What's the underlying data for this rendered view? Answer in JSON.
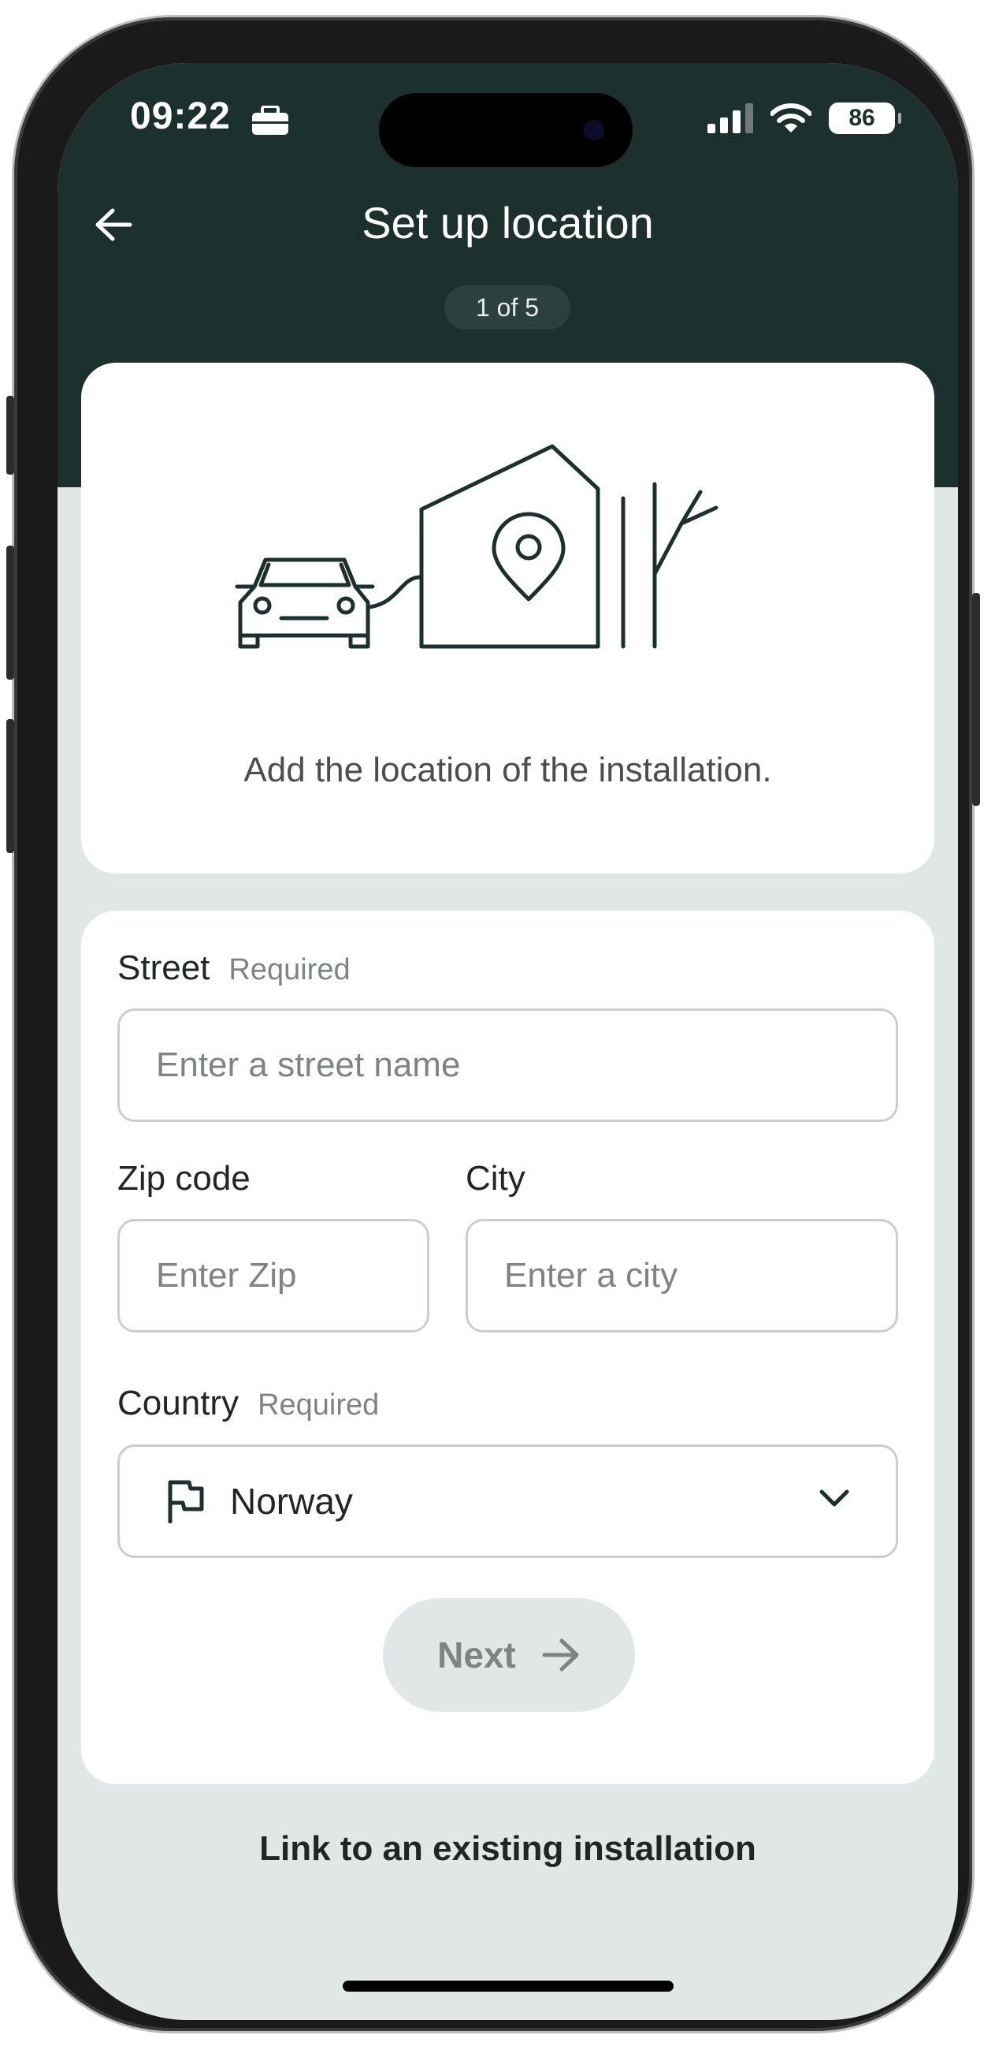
{
  "status_bar": {
    "time": "09:22",
    "battery": "86"
  },
  "header": {
    "title": "Set up location",
    "step": "1 of 5"
  },
  "intro": {
    "caption": "Add the location of the installation."
  },
  "form": {
    "street": {
      "label": "Street",
      "required": "Required",
      "placeholder": "Enter a street name",
      "value": ""
    },
    "zip": {
      "label": "Zip code",
      "placeholder": "Enter Zip",
      "value": ""
    },
    "city": {
      "label": "City",
      "placeholder": "Enter a city",
      "value": ""
    },
    "country": {
      "label": "Country",
      "required": "Required",
      "value": "Norway",
      "icon": "flag-icon"
    },
    "next_label": "Next"
  },
  "link_existing": "Link to an existing installation",
  "colors": {
    "header_bg": "#1c302e",
    "page_bg": "#e1e6e6",
    "card_bg": "#ffffff",
    "disabled_text": "#7d8483"
  }
}
